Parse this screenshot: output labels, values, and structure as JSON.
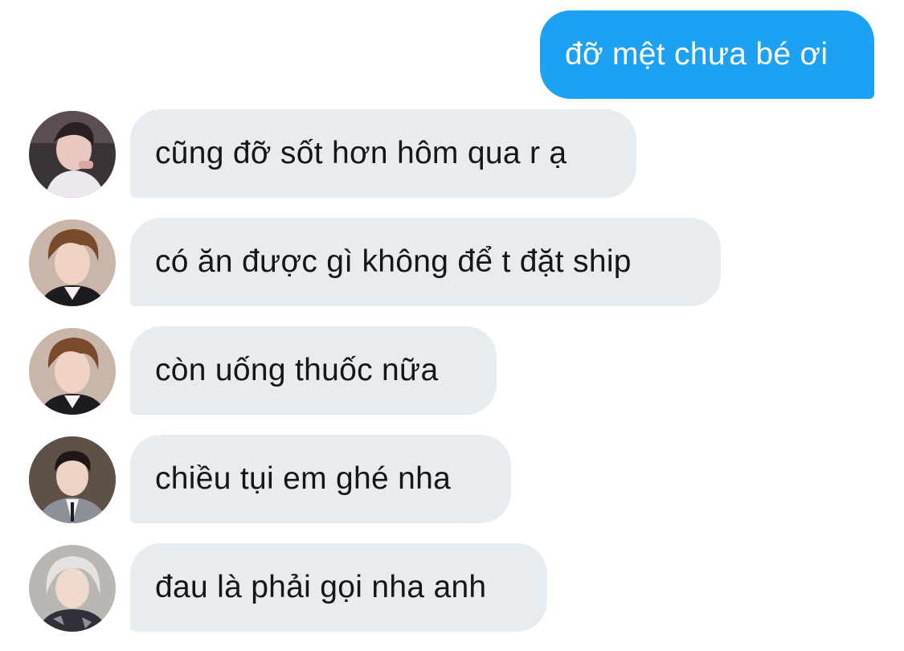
{
  "conversation": {
    "sent_message": {
      "text": "đỡ mệt chưa bé ơi",
      "color": "#1da1f2"
    },
    "received_messages": [
      {
        "text": "cũng đỡ sốt hơn hôm qua r ạ",
        "avatar": "avatar-1"
      },
      {
        "text": "có ăn được gì không để t đặt ship",
        "avatar": "avatar-2"
      },
      {
        "text": "còn uống thuốc nữa",
        "avatar": "avatar-2"
      },
      {
        "text": "chiều tụi em ghé nha",
        "avatar": "avatar-3"
      },
      {
        "text": "đau là phải gọi nha anh",
        "avatar": "avatar-4"
      }
    ],
    "received_bubble_color": "#e6ecf0"
  }
}
